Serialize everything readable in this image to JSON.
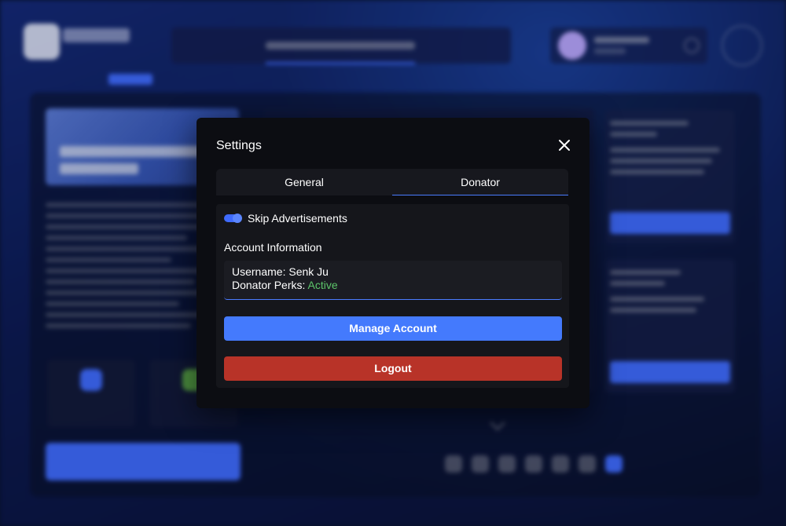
{
  "settings": {
    "title": "Settings",
    "tabs": [
      {
        "label": "General"
      },
      {
        "label": "Donator"
      }
    ],
    "skip_ads_label": "Skip Advertisements",
    "account_info_label": "Account Information",
    "username_prefix": "Username: ",
    "username": "Senk Ju",
    "perks_prefix": "Donator Perks: ",
    "perks_status": "Active",
    "manage_button": "Manage Account",
    "logout_button": "Logout"
  },
  "colors": {
    "accent": "#447afd",
    "danger": "#b83328",
    "success": "#5cc46a",
    "modal_bg": "#0c0d12"
  },
  "icons": {
    "close": "close-icon"
  }
}
